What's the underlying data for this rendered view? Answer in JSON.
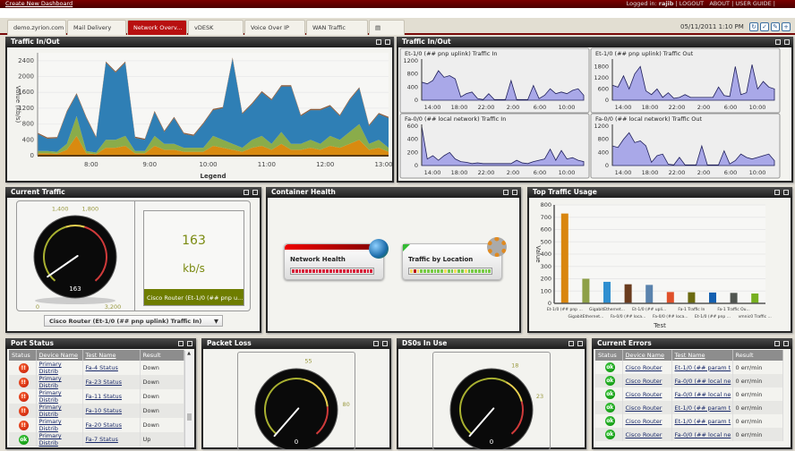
{
  "topbar": {
    "create_link": "Create New Dashboard",
    "logged_in_label": "Logged in:",
    "user": "rajib",
    "logout": "LOGOUT",
    "about": "ABOUT",
    "user_guide": "USER GUIDE"
  },
  "tabs": [
    {
      "label": "demo.zyrion.com"
    },
    {
      "label": "Mail Delivery"
    },
    {
      "label": "Network Overv...",
      "active": true
    },
    {
      "label": "vDESK"
    },
    {
      "label": "Voice Over IP"
    },
    {
      "label": "WAN Traffic"
    }
  ],
  "datetime": "05/11/2011 1:10 PM",
  "colors": {
    "brand": "#7a0000",
    "active_tab": "#b81010",
    "area_blue": "#2f7fb5",
    "area_green": "#8aac4a",
    "area_orange": "#d98a10",
    "area_brown": "#8a5a3a",
    "mini_fill": "#a9a8e8",
    "mini_line": "#1e1e5a"
  },
  "panels": {
    "traffic_main": "Traffic In/Out",
    "traffic_grid": "Traffic In/Out",
    "current_traffic": "Current Traffic",
    "container_health": "Container Health",
    "top_traffic": "Top Traffic Usage",
    "port_status": "Port Status",
    "packet_loss": "Packet Loss",
    "ds0s": "DS0s In Use",
    "current_errors": "Current Errors"
  },
  "chart_data": [
    {
      "type": "area",
      "stacked": true,
      "title": "Traffic In/Out",
      "ylabel": "Value (kb/s)",
      "xlabel": "Legend",
      "ylim": [
        0,
        2600
      ],
      "yticks": [
        0,
        400,
        800,
        1200,
        1600,
        2000,
        2400
      ],
      "xticks": [
        "8:00",
        "9:00",
        "10:00",
        "11:00",
        "12:00",
        "13:00"
      ],
      "x_start_minutes": 425,
      "x_step_minutes": 10,
      "series": [
        {
          "name": "orange",
          "color": "#d98a10",
          "values": [
            60,
            60,
            50,
            150,
            500,
            60,
            40,
            200,
            200,
            250,
            60,
            60,
            250,
            150,
            150,
            100,
            100,
            100,
            250,
            200,
            150,
            100,
            200,
            250,
            150,
            300,
            150,
            150,
            200,
            150,
            250,
            200,
            300,
            400,
            150,
            200,
            100
          ]
        },
        {
          "name": "green",
          "color": "#8aac4a",
          "values": [
            60,
            60,
            50,
            150,
            500,
            60,
            40,
            200,
            200,
            250,
            60,
            60,
            250,
            150,
            150,
            100,
            100,
            100,
            250,
            200,
            150,
            100,
            200,
            250,
            150,
            300,
            150,
            150,
            200,
            150,
            250,
            200,
            300,
            400,
            150,
            200,
            100
          ]
        },
        {
          "name": "blue",
          "color": "#2f7fb5",
          "values": [
            430,
            310,
            340,
            800,
            550,
            830,
            370,
            1950,
            1700,
            1850,
            330,
            280,
            600,
            300,
            650,
            350,
            300,
            600,
            650,
            800,
            2150,
            850,
            900,
            1100,
            1100,
            1150,
            1450,
            700,
            750,
            850,
            750,
            600,
            800,
            900,
            450,
            650,
            750
          ]
        },
        {
          "name": "brown",
          "color": "#8a5a3a",
          "values": [
            30,
            30,
            30,
            30,
            30,
            30,
            30,
            30,
            30,
            30,
            30,
            30,
            30,
            30,
            30,
            30,
            30,
            30,
            30,
            30,
            30,
            30,
            30,
            30,
            30,
            30,
            30,
            30,
            30,
            30,
            30,
            30,
            30,
            30,
            30,
            30,
            30
          ]
        }
      ]
    },
    {
      "type": "area",
      "title": "Et-1/0 (## pnp uplink) Traffic In",
      "ylim": [
        0,
        1200
      ],
      "yticks": [
        0,
        400,
        800,
        1200
      ],
      "xticks": [
        "14:00",
        "18:00",
        "22:00",
        "2:00",
        "6:00",
        "10:00"
      ],
      "values": [
        550,
        500,
        600,
        900,
        700,
        750,
        650,
        100,
        200,
        250,
        50,
        20,
        200,
        20,
        20,
        20,
        600,
        20,
        20,
        20,
        450,
        50,
        150,
        350,
        200,
        250,
        200,
        300,
        350,
        150
      ]
    },
    {
      "type": "area",
      "title": "Et-1/0 (## pnp uplink) Traffic Out",
      "ylim": [
        0,
        2100
      ],
      "yticks": [
        0,
        600,
        1200,
        1800
      ],
      "xticks": [
        "14:00",
        "18:00",
        "22:00",
        "2:00",
        "6:00",
        "10:00"
      ],
      "values": [
        800,
        700,
        1300,
        600,
        1400,
        1800,
        500,
        300,
        600,
        150,
        400,
        100,
        150,
        300,
        150,
        150,
        150,
        150,
        150,
        700,
        250,
        200,
        1800,
        300,
        400,
        1900,
        600,
        1000,
        700,
        600
      ]
    },
    {
      "type": "area",
      "title": "Fa-0/0 (## local network) Traffic In",
      "ylim": [
        0,
        600
      ],
      "yticks": [
        0,
        200,
        400,
        600
      ],
      "xticks": [
        "14:00",
        "18:00",
        "22:00",
        "2:00",
        "6:00",
        "10:00"
      ],
      "values": [
        600,
        100,
        150,
        80,
        150,
        200,
        100,
        60,
        50,
        30,
        40,
        30,
        30,
        30,
        30,
        30,
        30,
        80,
        40,
        30,
        60,
        80,
        100,
        250,
        80,
        230,
        100,
        120,
        80,
        60
      ]
    },
    {
      "type": "area",
      "title": "Fa-0/0 (## local network) Traffic Out",
      "ylim": [
        0,
        1200
      ],
      "yticks": [
        0,
        400,
        800,
        1200
      ],
      "xticks": [
        "14:00",
        "18:00",
        "22:00",
        "2:00",
        "6:00",
        "10:00"
      ],
      "values": [
        600,
        550,
        800,
        1000,
        700,
        750,
        600,
        100,
        300,
        350,
        40,
        20,
        250,
        20,
        20,
        20,
        600,
        20,
        20,
        20,
        450,
        50,
        150,
        350,
        250,
        200,
        250,
        300,
        350,
        150
      ]
    },
    {
      "type": "bar",
      "title": "Top Traffic Usage",
      "xlabel": "Test",
      "ylabel": "Value",
      "ylim": [
        0,
        800
      ],
      "yticks": [
        0,
        100,
        200,
        300,
        400,
        500,
        600,
        700,
        800
      ],
      "categories": [
        "Et-1/0 (## pnp ...",
        "GigabitEthernet...",
        "GigabitEthernet...",
        "Fa-0/0 (## loca...",
        "Et-1/0 (## upli...",
        "Fa-0/0 (## loca...",
        "Fa-1 Traffic In",
        "Et-1/0 (## pnp ...",
        "Fa-1 Traffic Ou...",
        "vmnic0 Traffic ..."
      ],
      "values": [
        730,
        200,
        175,
        155,
        150,
        92,
        90,
        88,
        85,
        80
      ],
      "colors": [
        "#d9860f",
        "#8ea048",
        "#2f8fd0",
        "#6a3c1e",
        "#5a83ad",
        "#e0502a",
        "#6b6a10",
        "#1460b0",
        "#505550",
        "#77b020"
      ]
    }
  ],
  "current_traffic": {
    "value": 163,
    "value_label": "163",
    "unit": "kb/s",
    "min": 0,
    "max": 3200,
    "warn": 1400,
    "crit": 1800,
    "labels": {
      "warn": "1,400",
      "crit": "1,800",
      "min": "0",
      "max": "3,200"
    },
    "device_label": "Cisco Router (Et-1/0 (## pnp u...",
    "select_value": "Cisco Router (Et-1/0 (## pnp uplink) Traffic In)"
  },
  "container_health": {
    "cards": [
      {
        "label": "Network Health"
      },
      {
        "label": "Traffic by Location"
      }
    ]
  },
  "packet_loss": {
    "value": 0,
    "value_label": "0",
    "min": 0,
    "max": 100,
    "warn": 55,
    "crit": 80,
    "labels": {
      "warn": "55",
      "crit": "80"
    }
  },
  "ds0s": {
    "value": 0,
    "value_label": "0",
    "min": 0,
    "max": 30,
    "warn": 18,
    "crit": 23,
    "labels": {
      "warn": "18",
      "crit": "23"
    }
  },
  "port_status": {
    "headers": [
      "Status",
      "Device Name",
      "Test Name",
      "Result"
    ],
    "rows": [
      {
        "status": "down",
        "device": "Primary Distrib",
        "test": "Fa-4 Status",
        "result": "Down"
      },
      {
        "status": "down",
        "device": "Primary Distrib",
        "test": "Fa-23 Status",
        "result": "Down"
      },
      {
        "status": "down",
        "device": "Primary Distrib",
        "test": "Fa-11 Status",
        "result": "Down"
      },
      {
        "status": "down",
        "device": "Primary Distrib",
        "test": "Fa-10 Status",
        "result": "Down"
      },
      {
        "status": "down",
        "device": "Primary Distrib",
        "test": "Fa-20 Status",
        "result": "Down"
      },
      {
        "status": "ok",
        "device": "Primary Distrib",
        "test": "Fa-7 Status",
        "result": "Up"
      }
    ]
  },
  "current_errors": {
    "headers": [
      "Status",
      "Device Name",
      "Test Name",
      "Result"
    ],
    "rows": [
      {
        "device": "Cisco Router",
        "test": "Et-1/0 (## param t",
        "result": "0 err/min"
      },
      {
        "device": "Cisco Router",
        "test": "Fa-0/0 (## local ne",
        "result": "0 err/min"
      },
      {
        "device": "Cisco Router",
        "test": "Fa-0/0 (## local ne",
        "result": "0 err/min"
      },
      {
        "device": "Cisco Router",
        "test": "Et-1/0 (## param t",
        "result": "0 err/min"
      },
      {
        "device": "Cisco Router",
        "test": "Et-1/0 (## param t",
        "result": "0 err/min"
      },
      {
        "device": "Cisco Router",
        "test": "Fa-0/0 (## local ne",
        "result": "0 err/min"
      }
    ]
  },
  "status_icons": {
    "down": "!!",
    "ok": "ok"
  }
}
